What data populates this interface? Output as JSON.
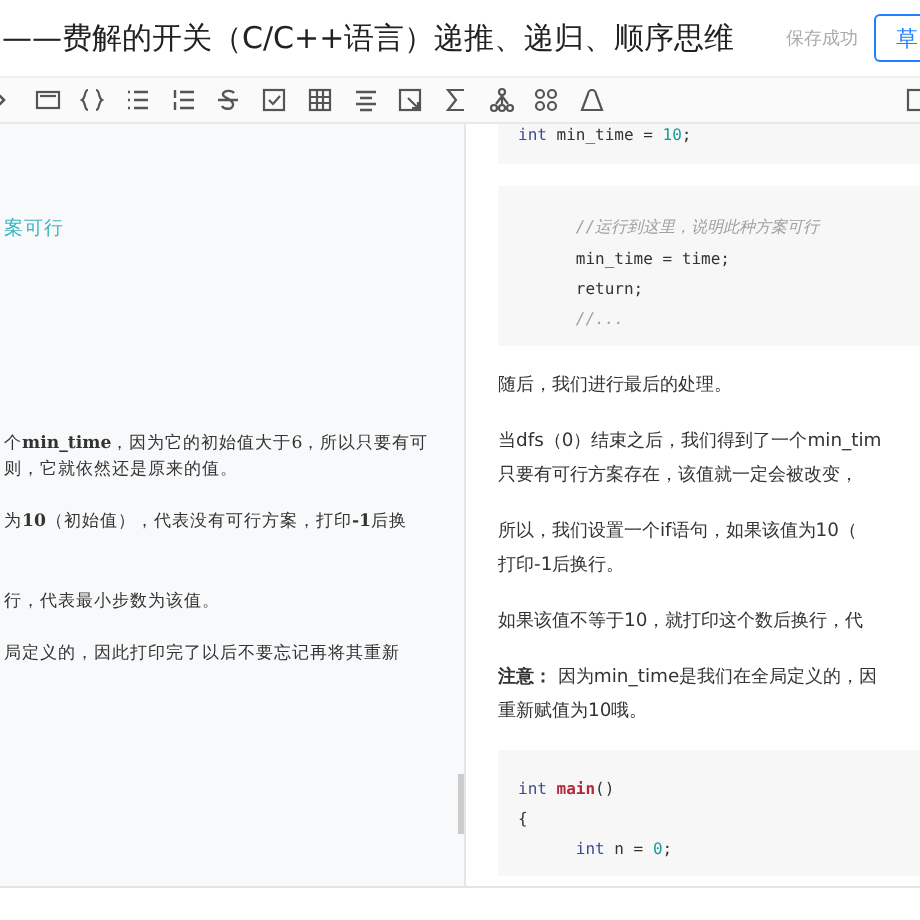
{
  "header": {
    "title": "——费解的开关（C/C++语言）递推、递归、顺序思维",
    "save_status": "保存成功",
    "draft_button": "草"
  },
  "source_pane": {
    "paragraphs": [
      {
        "kind": "link",
        "lines": [
          "案可行"
        ]
      },
      {
        "kind": "text",
        "lines": [
          "个**min_time**，因为它的初始值大于6，所以只要有可",
          "则，它就依然还是原来的值。"
        ]
      },
      {
        "kind": "text",
        "lines": [
          "为**10**（初始值），代表没有可行方案，打印**-1**后换"
        ]
      },
      {
        "kind": "text",
        "lines": [
          "行，代表最小步数为该值。"
        ]
      },
      {
        "kind": "text",
        "lines": [
          "局定义的，因此打印完了以后不要忘记再将其重新"
        ]
      }
    ]
  },
  "preview_pane": {
    "blocks": [
      {
        "kind": "code",
        "lines": [
          [
            {
              "t": "int",
              "kind": "keyword"
            },
            {
              "t": " min_time = ",
              "kind": "plain"
            },
            {
              "t": "10",
              "kind": "number"
            },
            {
              "t": ";",
              "kind": "plain"
            }
          ]
        ]
      },
      {
        "kind": "code",
        "lines": [
          [
            {
              "t": "\t//运行到这里，说明此种方案可行",
              "kind": "comment"
            }
          ],
          [
            {
              "t": "\tmin_time = time;",
              "kind": "plain"
            }
          ],
          [
            {
              "t": "\treturn;",
              "kind": "plain"
            }
          ],
          [
            {
              "t": "\t//...",
              "kind": "comment"
            }
          ]
        ]
      },
      {
        "kind": "paragraph",
        "lines": [
          "随后，我们进行最后的处理。"
        ]
      },
      {
        "kind": "paragraph",
        "lines": [
          "当dfs（0）结束之后，我们得到了一个min_tim",
          "只要有可行方案存在，该值就一定会被改变，"
        ]
      },
      {
        "kind": "paragraph",
        "lines": [
          "所以，我们设置一个if语句，如果该值为10（",
          "打印-1后换行。"
        ]
      },
      {
        "kind": "paragraph",
        "lines": [
          "如果该值不等于10，就打印这个数后换行，代"
        ]
      },
      {
        "kind": "paragraph",
        "lines": [
          "**注意：** 因为min_time是我们在全局定义的，因",
          "重新赋值为10哦。"
        ]
      },
      {
        "kind": "code",
        "lines": [
          [
            {
              "t": "int ",
              "kind": "keyword"
            },
            {
              "t": "main",
              "kind": "function"
            },
            {
              "t": "()",
              "kind": "plain"
            }
          ],
          [
            {
              "t": "{",
              "kind": "plain"
            }
          ],
          [
            {
              "t": "\tint",
              "kind": "keyword"
            },
            {
              "t": " n = ",
              "kind": "plain"
            },
            {
              "t": "0",
              "kind": "number"
            },
            {
              "t": ";",
              "kind": "plain"
            }
          ]
        ]
      }
    ]
  }
}
